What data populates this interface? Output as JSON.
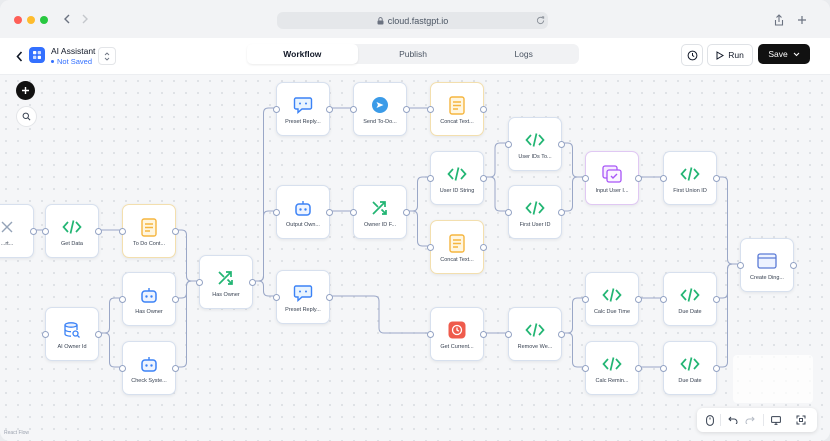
{
  "browser": {
    "url": "cloud.fastgpt.io"
  },
  "app": {
    "name": "AI Assistant",
    "status": "Not Saved"
  },
  "tabs": [
    "Workflow",
    "Publish",
    "Logs"
  ],
  "actions": {
    "run_label": "Run",
    "save_label": "Save"
  },
  "footer": {
    "watermark": "React Flow"
  },
  "colors": {
    "accent": "#3370ff",
    "node_green": "#22b573",
    "node_amber": "#f5b53f",
    "node_blue": "#3b82f6",
    "node_purple": "#a855f7",
    "node_red": "#ef5b4c",
    "edge": "#9aa7c7"
  },
  "nodes": [
    {
      "id": "n0",
      "label": "...rt...",
      "icon": "partial-node-icon"
    },
    {
      "id": "n1",
      "label": "Get Data",
      "icon": "code-icon"
    },
    {
      "id": "n2",
      "label": "To Do Cont...",
      "icon": "text-concat-icon"
    },
    {
      "id": "n3",
      "label": "AI Owner Id",
      "icon": "database-icon"
    },
    {
      "id": "n4",
      "label": "Has Owner",
      "icon": "bot-icon"
    },
    {
      "id": "n5",
      "label": "Check Syste...",
      "icon": "bot-icon"
    },
    {
      "id": "n6",
      "label": "Has Owner",
      "icon": "branch-icon"
    },
    {
      "id": "n7",
      "label": "Preset Reply...",
      "icon": "chat-icon"
    },
    {
      "id": "n8",
      "label": "Output Own...",
      "icon": "bot-icon"
    },
    {
      "id": "n9",
      "label": "Preset Reply...",
      "icon": "chat-icon"
    },
    {
      "id": "n10",
      "label": "Send To-Do...",
      "icon": "send-icon"
    },
    {
      "id": "n11",
      "label": "Owner ID F...",
      "icon": "branch-icon"
    },
    {
      "id": "n12",
      "label": "Concat Text...",
      "icon": "text-concat-icon"
    },
    {
      "id": "n13",
      "label": "User ID String",
      "icon": "code-icon"
    },
    {
      "id": "n14",
      "label": "Concat Text...",
      "icon": "text-concat-icon"
    },
    {
      "id": "n15",
      "label": "Get Current...",
      "icon": "clock-icon"
    },
    {
      "id": "n16",
      "label": "User IDs To...",
      "icon": "code-icon"
    },
    {
      "id": "n17",
      "label": "First User ID",
      "icon": "code-icon"
    },
    {
      "id": "n18",
      "label": "Remove We...",
      "icon": "code-icon"
    },
    {
      "id": "n19",
      "label": "Input User I...",
      "icon": "form-icon"
    },
    {
      "id": "n20",
      "label": "Calc Due Time",
      "icon": "code-icon"
    },
    {
      "id": "n21",
      "label": "Calc Remin...",
      "icon": "code-icon"
    },
    {
      "id": "n22",
      "label": "First Union ID",
      "icon": "code-icon"
    },
    {
      "id": "n23",
      "label": "Due Date",
      "icon": "code-icon"
    },
    {
      "id": "n24",
      "label": "Due Date",
      "icon": "code-icon"
    },
    {
      "id": "n25",
      "label": "Create Ding...",
      "icon": "window-icon"
    }
  ]
}
